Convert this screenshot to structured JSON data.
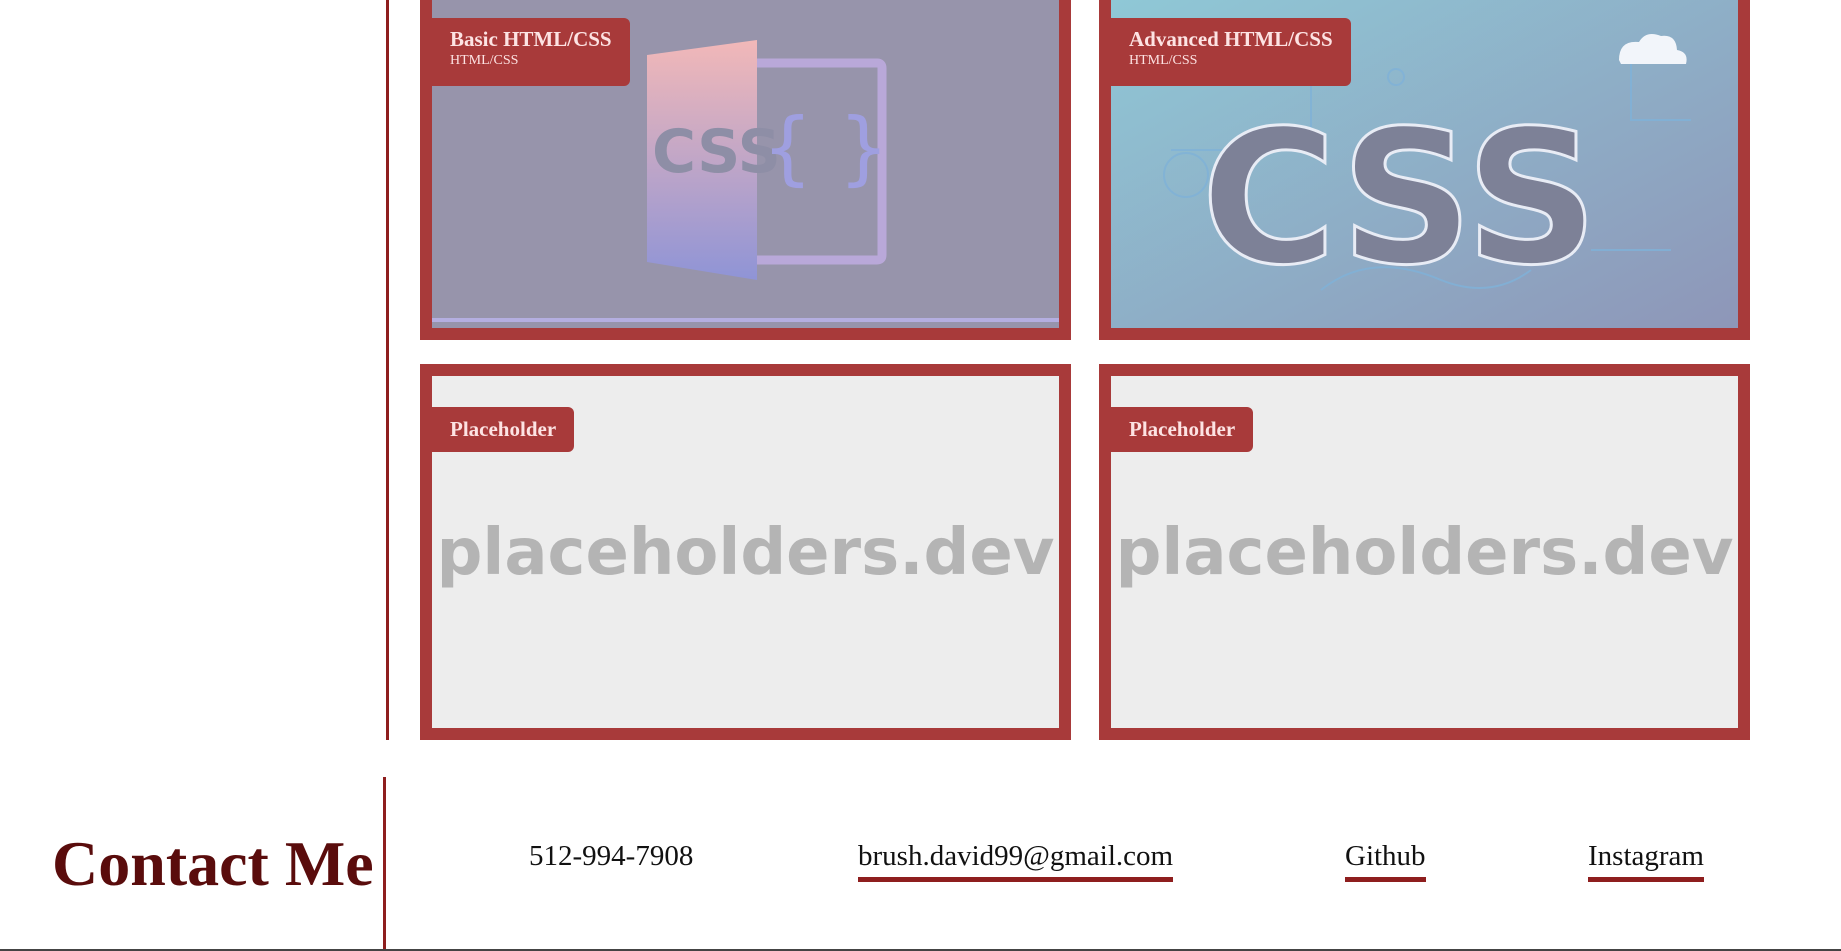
{
  "projects": [
    {
      "title": "Basic HTML/CSS",
      "subtitle": "HTML/CSS",
      "image_text": "CSS"
    },
    {
      "title": "Advanced HTML/CSS",
      "subtitle": "HTML/CSS",
      "image_text": "CSS"
    },
    {
      "title": "Placeholder",
      "subtitle": "",
      "image_text": "placeholders.dev"
    },
    {
      "title": "Placeholder",
      "subtitle": "",
      "image_text": "placeholders.dev"
    }
  ],
  "contact": {
    "heading": "Contact Me",
    "phone": "512-994-7908",
    "email": "brush.david99@gmail.com",
    "github": "Github",
    "instagram": "Instagram"
  },
  "colors": {
    "accent": "#a83a3a",
    "rule": "#8e1e1e",
    "heading": "#5a0c0c",
    "placeholder_bg": "#ededed"
  }
}
